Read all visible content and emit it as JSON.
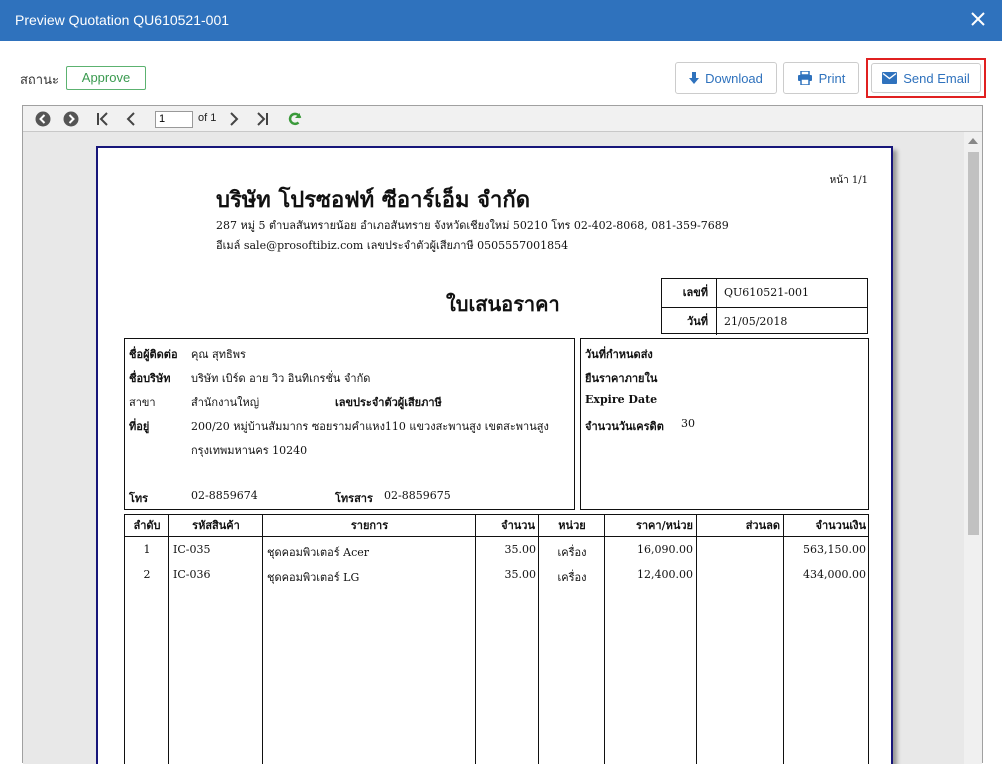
{
  "window": {
    "title": "Preview Quotation QU610521-001"
  },
  "toolbar": {
    "status_label": "สถานะ",
    "approve_label": "Approve",
    "download_label": "Download",
    "print_label": "Print",
    "send_email_label": "Send Email"
  },
  "viewer": {
    "page_value": "1",
    "page_of": "of 1"
  },
  "document": {
    "page_no": "หน้า 1/1",
    "company_name": "บริษัท โปรซอฟท์ ซีอาร์เอ็ม จำกัด",
    "address_line1": "287 หมู่ 5 ตำบลสันทรายน้อย อำเภอสันทราย จังหวัดเชียงใหม่ 50210 โทร 02-402-8068, 081-359-7689",
    "address_line2": "อีเมล์ sale@prosoftibiz.com เลขประจำตัวผู้เสียภาษี 0505557001854",
    "title": "ใบเสนอราคา",
    "ref_no_label": "เลขที่",
    "ref_no": "QU610521-001",
    "date_label": "วันที่",
    "date": "21/05/2018",
    "customer": {
      "contact_label": "ชื่อผู้ติดต่อ",
      "contact": "คุณ สุทธิพร",
      "company_label": "ชื่อบริษัท",
      "company": "บริษัท เบิร์ด อาย วิว อินทิเกรชั่น จำกัด",
      "branch_label": "สาขา",
      "branch": "สำนักงานใหญ่",
      "taxid_label": "เลขประจำตัวผู้เสียภาษี",
      "address_label": "ที่อยู่",
      "address1": "200/20 หมู่บ้านสัมมากร ซอยรามคำแหง110 แขวงสะพานสูง เขตสะพานสูง",
      "address2": "กรุงเทพมหานคร 10240",
      "phone_label": "โทร",
      "phone": "02-8859674",
      "fax_label": "โทรสาร",
      "fax": "02-8859675"
    },
    "terms": {
      "delivery_label": "วันที่กำหนดส่ง",
      "valid_label": "ยืนราคาภายใน",
      "expire_label": "Expire Date",
      "credit_label": "จำนวนวันเครดิต",
      "credit": "30"
    },
    "items_headers": [
      "ลำดับ",
      "รหัสสินค้า",
      "รายการ",
      "จำนวน",
      "หน่วย",
      "ราคา/หน่วย",
      "ส่วนลด",
      "จำนวนเงิน"
    ],
    "items": [
      {
        "no": "1",
        "code": "IC-035",
        "desc": "ชุดคอมพิวเตอร์ Acer",
        "qty": "35.00",
        "unit": "เครื่อง",
        "price": "16,090.00",
        "discount": "",
        "amount": "563,150.00"
      },
      {
        "no": "2",
        "code": "IC-036",
        "desc": "ชุดคอมพิวเตอร์ LG",
        "qty": "35.00",
        "unit": "เครื่อง",
        "price": "12,400.00",
        "discount": "",
        "amount": "434,000.00"
      }
    ]
  },
  "colors": {
    "titlebar": "#2f72bd",
    "approve": "#3a9a4f",
    "highlight": "#e02020",
    "paper_border": "#17167a"
  }
}
